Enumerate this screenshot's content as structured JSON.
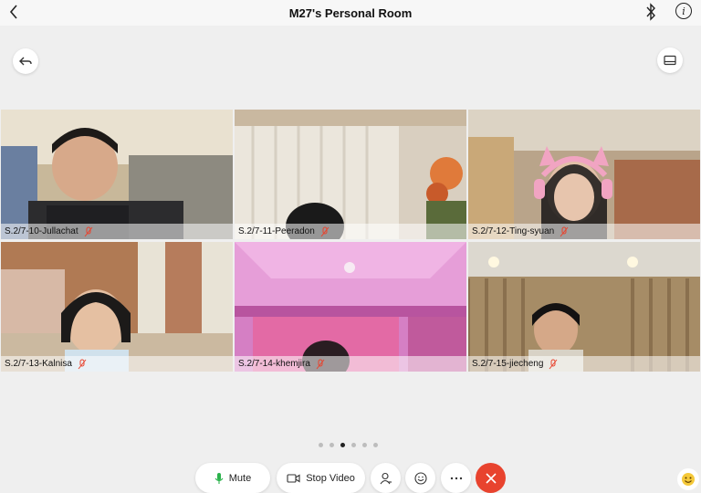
{
  "header": {
    "title": "M27's Personal Room"
  },
  "participants": [
    {
      "name": "S.2/7-10-Jullachat"
    },
    {
      "name": "S.2/7-11-Peeradon"
    },
    {
      "name": "S.2/7-12-Ting-syuan"
    },
    {
      "name": "S.2/7-13-Kalnisa"
    },
    {
      "name": "S.2/7-14-khemjira"
    },
    {
      "name": "S.2/7-15-jiecheng"
    }
  ],
  "pagination": {
    "pages": 6,
    "current": 3
  },
  "controls": {
    "mute_label": "Mute",
    "stop_video_label": "Stop Video"
  },
  "icons": {
    "back": "chevron-left-icon",
    "bluetooth": "bluetooth-icon",
    "info": "info-icon",
    "return": "return-arrow-icon",
    "layout": "layout-icon",
    "muted_mic": "mic-muted-icon",
    "participants": "participants-icon",
    "reactions": "smiley-icon",
    "more": "more-icon",
    "leave": "close-icon"
  },
  "colors": {
    "leave": "#e8432e",
    "mic_green": "#2bb24c",
    "muted_red": "#e8432e"
  }
}
